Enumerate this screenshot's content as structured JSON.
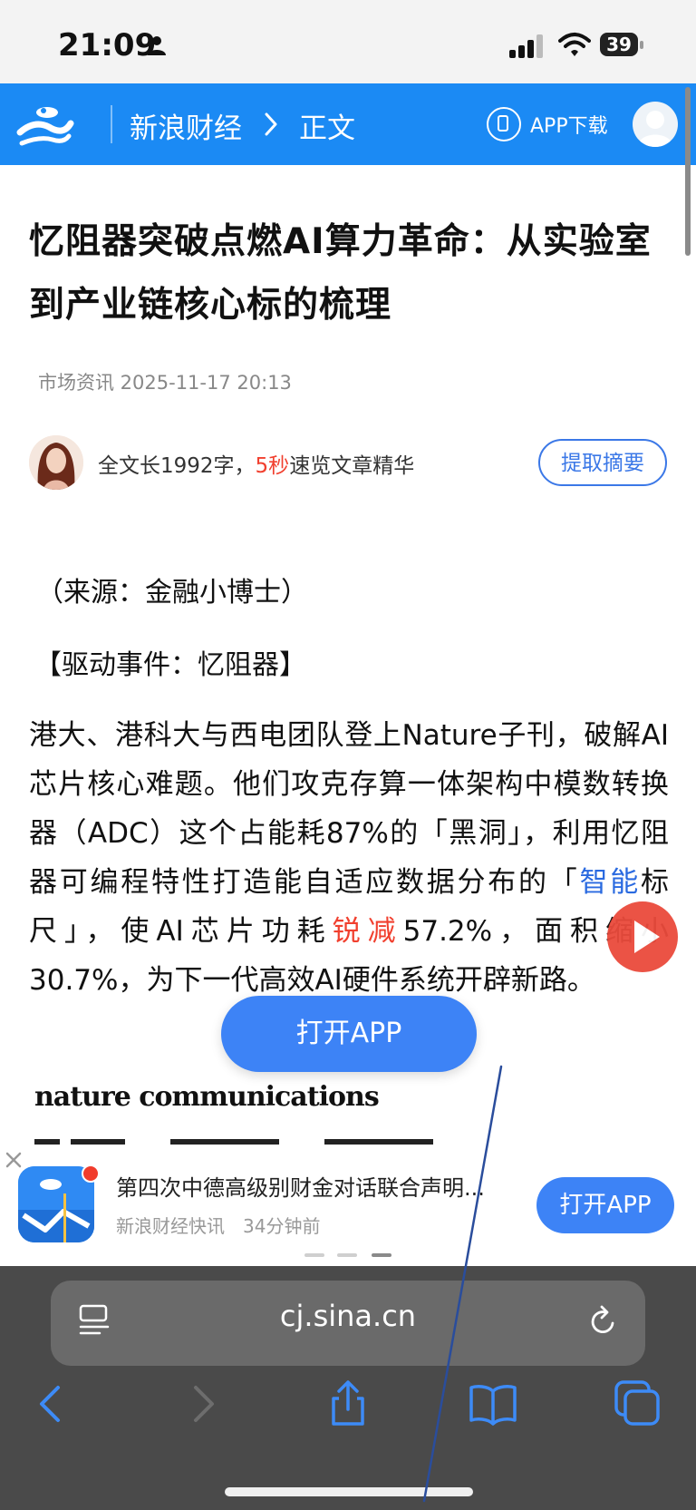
{
  "status_bar": {
    "time": "21:09",
    "battery": "39"
  },
  "header": {
    "brand": "新浪财经",
    "breadcrumb_current": "正文",
    "app_download": "APP下载"
  },
  "article": {
    "title": "忆阻器突破点燃AI算力革命：从实验室到产业链核心标的梳理",
    "meta": "市场资讯 2025-11-17 20:13",
    "summary_prefix": "全文长1992字，",
    "summary_highlight": "5秒",
    "summary_suffix": "速览文章精华",
    "extract_button": "提取摘要",
    "source": "（来源：金融小博士）",
    "event": "【驱动事件：忆阻器】",
    "body_part1": "港大、港科大与西电团队登上Nature子刊，破解AI芯片核心难题。他们攻克存算一体架构中模数转换器（ADC）这个占能耗87%的「黑洞」，利用忆阻器可编程特性打造能自适应数据分布的「",
    "body_link": "智能",
    "body_part2": "标尺」，使AI芯片功耗",
    "body_red": "锐减",
    "body_part3": "57.2%，面积缩小30.7%，为下一代高效AI硬件系统开辟新路。",
    "nature_heading": "nature communications"
  },
  "floating_button": "打开APP",
  "news_banner": {
    "title": "第四次中德高级别财金对话联合声明...",
    "source": "新浪财经快讯",
    "time": "34分钟前",
    "button": "打开APP"
  },
  "browser": {
    "url": "cj.sina.cn"
  },
  "colors": {
    "brand_blue": "#1b8af4",
    "button_blue": "#3d83f6",
    "highlight_red": "#f1402f",
    "link_blue": "#2a6ae0"
  }
}
